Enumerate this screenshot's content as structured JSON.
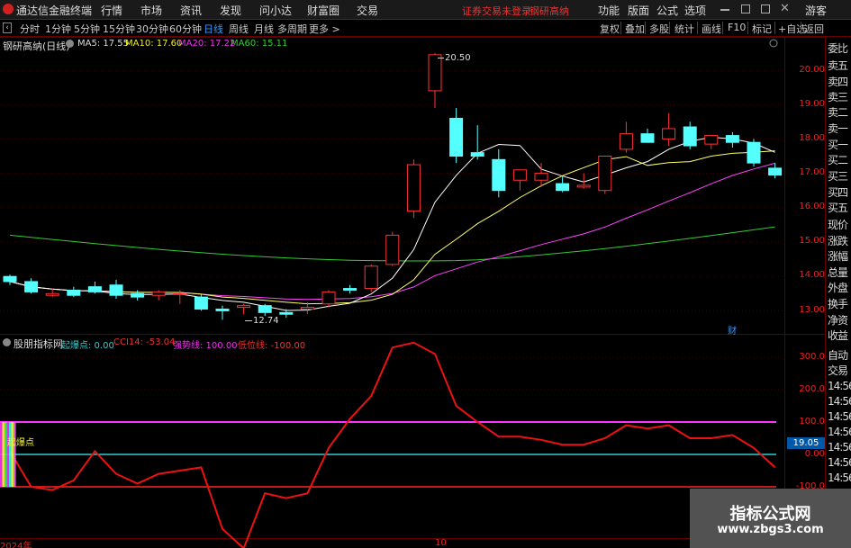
{
  "app_title": "通达信金融终端",
  "menu": [
    "行情",
    "市场",
    "资讯",
    "发现",
    "问小达",
    "财富圈",
    "交易"
  ],
  "warning": "证券交易未登录",
  "stock_menu_name": "钢研高纳",
  "right_menu": [
    "功能",
    "版面",
    "公式",
    "选项"
  ],
  "guest": "游客",
  "periods": [
    "分时",
    "1分钟",
    "5分钟",
    "15分钟",
    "30分钟",
    "60分钟",
    "日线",
    "周线",
    "月线",
    "多周期",
    "更多 >"
  ],
  "active_period": "日线",
  "tools": [
    "复权",
    "叠加",
    "多股",
    "统计",
    "画线",
    "F10",
    "标记",
    "+自选",
    "返回"
  ],
  "main": {
    "stock_title": "钢研高纳(日线)",
    "ma5": "MA5: 17.55",
    "ma10": "MA10: 17.60",
    "ma20": "MA20: 17.22",
    "ma60": "MA60: 15.11",
    "high_label": "20.50",
    "low_label": "12.74",
    "cai_mark": "财",
    "y_ticks": [
      "20.00",
      "19.00",
      "18.00",
      "17.00",
      "16.00",
      "15.00",
      "14.00",
      "13.00"
    ],
    "ma_colors": {
      "ma5": "#ffffff",
      "ma10": "#ffff66",
      "ma20": "#ff44ff",
      "ma60": "#33cc33"
    },
    "candles": [
      [
        14.0,
        14.05,
        13.75,
        13.85
      ],
      [
        13.85,
        13.95,
        13.5,
        13.55
      ],
      [
        13.45,
        13.65,
        13.4,
        13.5
      ],
      [
        13.6,
        13.7,
        13.4,
        13.45
      ],
      [
        13.7,
        13.85,
        13.5,
        13.55
      ],
      [
        13.75,
        13.9,
        13.35,
        13.45
      ],
      [
        13.5,
        13.6,
        13.3,
        13.4
      ],
      [
        13.45,
        13.6,
        13.3,
        13.55
      ],
      [
        13.5,
        13.6,
        13.2,
        13.5
      ],
      [
        13.4,
        13.5,
        13.0,
        13.05
      ],
      [
        13.05,
        13.15,
        12.74,
        13.0
      ],
      [
        13.1,
        13.2,
        12.9,
        13.15
      ],
      [
        13.15,
        13.2,
        12.85,
        12.95
      ],
      [
        12.95,
        13.05,
        12.8,
        12.9
      ],
      [
        13.05,
        13.25,
        12.9,
        13.1
      ],
      [
        13.2,
        13.6,
        13.1,
        13.55
      ],
      [
        13.65,
        13.75,
        13.5,
        13.6
      ],
      [
        13.65,
        14.35,
        13.55,
        14.3
      ],
      [
        14.35,
        15.3,
        14.3,
        15.2
      ],
      [
        15.9,
        17.4,
        15.7,
        17.25
      ],
      [
        19.4,
        20.5,
        18.9,
        20.45
      ],
      [
        18.6,
        18.9,
        17.3,
        17.5
      ],
      [
        17.6,
        18.4,
        17.4,
        17.5
      ],
      [
        17.4,
        17.7,
        16.3,
        16.5
      ],
      [
        16.8,
        17.1,
        16.5,
        17.1
      ],
      [
        16.8,
        17.3,
        16.6,
        17.0
      ],
      [
        16.7,
        16.9,
        16.45,
        16.5
      ],
      [
        16.6,
        17.0,
        16.55,
        16.65
      ],
      [
        16.5,
        17.5,
        16.4,
        17.5
      ],
      [
        17.7,
        18.5,
        17.6,
        18.15
      ],
      [
        18.15,
        18.3,
        17.9,
        17.9
      ],
      [
        18.0,
        18.75,
        17.8,
        18.3
      ],
      [
        18.35,
        18.5,
        17.7,
        17.8
      ],
      [
        17.85,
        18.1,
        17.7,
        18.1
      ],
      [
        18.1,
        18.2,
        17.75,
        17.9
      ],
      [
        17.9,
        18.0,
        17.2,
        17.3
      ],
      [
        17.15,
        17.3,
        16.85,
        16.95
      ]
    ]
  },
  "sub": {
    "indicator_name": "股朋指标网",
    "qibao_label": "起爆点: 0.00",
    "cci_label": "CCI14: -53.04",
    "strong_label": "强势线: 100.00",
    "low_label": "低位线: -100.00",
    "qibao_mark": "起爆点",
    "y_ticks": [
      "300.0",
      "200.0",
      "100.0",
      "0.00",
      "-100.0"
    ],
    "current_value": "19.05",
    "cci_values": [
      10,
      -100,
      -110,
      -80,
      10,
      -60,
      -90,
      -60,
      -50,
      -40,
      -230,
      -290,
      -120,
      -135,
      -120,
      20,
      110,
      180,
      330,
      345,
      310,
      150,
      100,
      55,
      55,
      45,
      30,
      30,
      50,
      90,
      80,
      90,
      50,
      50,
      60,
      20,
      -40
    ]
  },
  "sidebar": [
    "委比",
    "卖五",
    "卖四",
    "卖三",
    "卖二",
    "卖一",
    "买一",
    "买二",
    "买三",
    "买四",
    "买五",
    "现价",
    "涨跌",
    "涨幅",
    "总量",
    "外盘",
    "换手",
    "净资",
    "收益",
    "自动",
    "交易",
    "14:56",
    "14:56",
    "14:56",
    "14:56",
    "14:56",
    "14:56",
    "14:56"
  ],
  "x_axis": {
    "year": "2024年",
    "month": "10"
  },
  "watermark": {
    "name": "指标公式网",
    "url": "www.zbgs3.com"
  }
}
